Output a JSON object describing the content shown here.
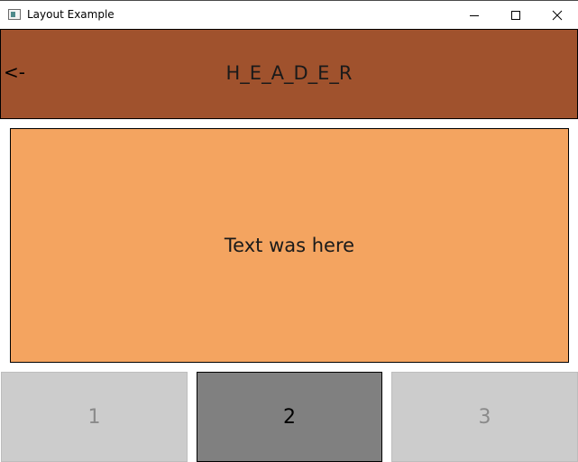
{
  "window": {
    "title": "Layout Example",
    "controls": {
      "minimize": "minimize",
      "maximize": "maximize",
      "close": "close"
    }
  },
  "header": {
    "back_label": "<-",
    "title": "H_E_A_D_E_R",
    "background": "#a0522d"
  },
  "content": {
    "text": "Text was here",
    "background": "#f4a460"
  },
  "tabs": [
    {
      "label": "1",
      "selected": false
    },
    {
      "label": "2",
      "selected": true
    },
    {
      "label": "3",
      "selected": false
    }
  ],
  "colors": {
    "tab_inactive": "#cccccc",
    "tab_active": "#808080"
  }
}
